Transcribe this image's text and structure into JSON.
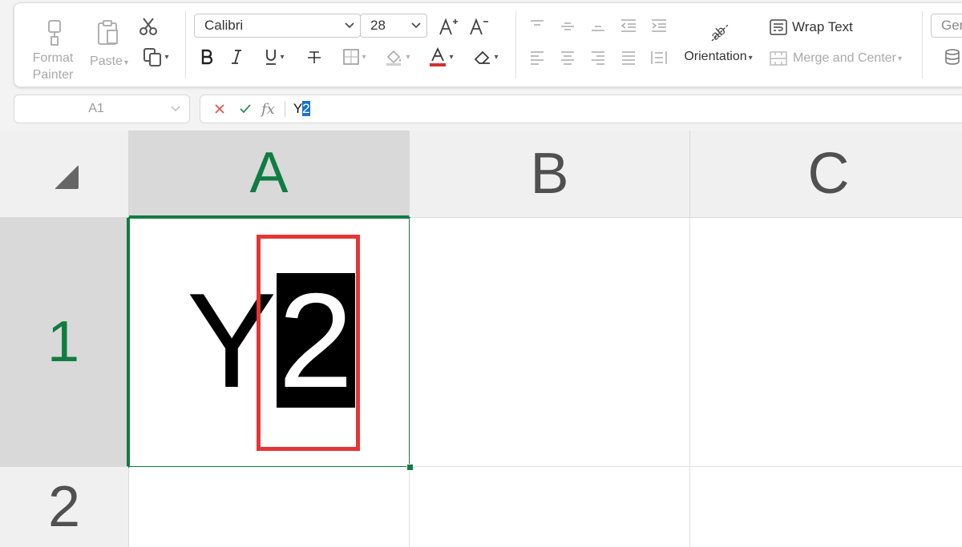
{
  "ribbon": {
    "clipboard": {
      "format_painter_label_1": "Format",
      "format_painter_label_2": "Painter",
      "paste_label": "Paste"
    },
    "font": {
      "family": "Calibri",
      "size": "28"
    },
    "alignment": {
      "wrap_text_label": "Wrap Text",
      "orientation_label": "Orientation",
      "merge_center_label": "Merge and Center"
    },
    "number": {
      "format_partial": "Ger"
    }
  },
  "formula_bar": {
    "name_box": "A1",
    "fx_label": "fx",
    "content_plain": "Y",
    "content_selected": "2"
  },
  "grid": {
    "columns": [
      "A",
      "B",
      "C"
    ],
    "rows": [
      "1",
      "2"
    ],
    "active_cell": "A1",
    "cell_a1_plain": "Y",
    "cell_a1_selected": "2"
  },
  "colors": {
    "accent_green": "#107c41",
    "highlight_red": "#e63535",
    "selection_blue": "#1a73c9"
  }
}
